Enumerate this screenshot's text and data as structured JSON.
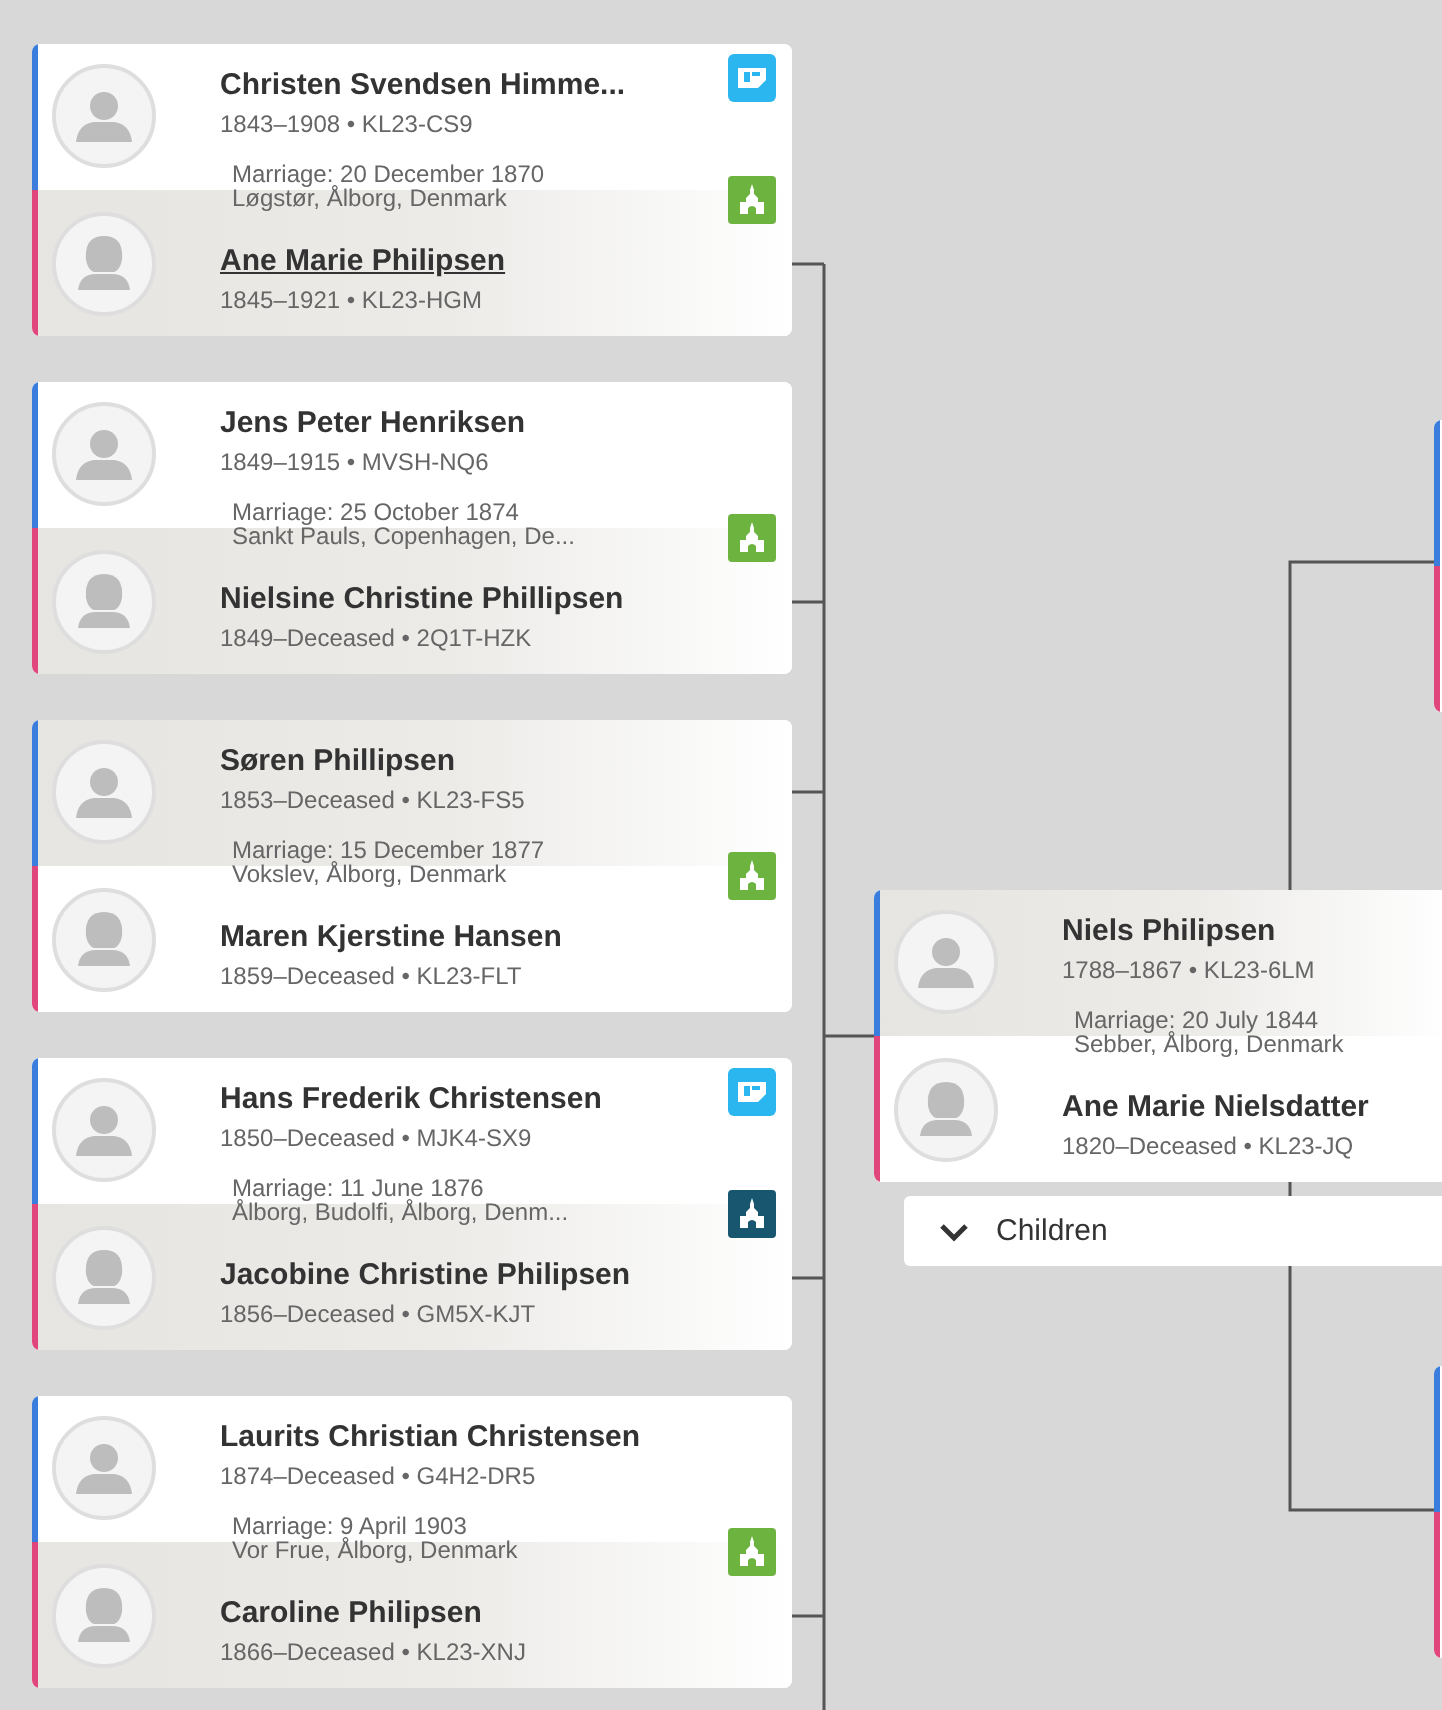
{
  "families": [
    {
      "husband": {
        "name": "Christen Svendsen Himme...",
        "details": "1843–1908 • KL23-CS9",
        "shaded": false,
        "underlined": false,
        "hint": true
      },
      "wife": {
        "name": "Ane Marie Philipsen",
        "details": "1845–1921 • KL23-HGM",
        "shaded": true,
        "underlined": true,
        "hint": false
      },
      "marriage": {
        "date": "Marriage: 20 December 1870",
        "place": "Løgstør, Ålborg, Denmark",
        "color": "#6cb33f"
      }
    },
    {
      "husband": {
        "name": "Jens Peter Henriksen",
        "details": "1849–1915 • MVSH-NQ6",
        "shaded": false,
        "underlined": false,
        "hint": false
      },
      "wife": {
        "name": "Nielsine Christine Phillipsen",
        "details": "1849–Deceased • 2Q1T-HZK",
        "shaded": true,
        "underlined": false,
        "hint": false
      },
      "marriage": {
        "date": "Marriage: 25 October 1874",
        "place": "Sankt Pauls, Copenhagen, De...",
        "color": "#6cb33f"
      }
    },
    {
      "husband": {
        "name": "Søren Phillipsen",
        "details": "1853–Deceased • KL23-FS5",
        "shaded": true,
        "underlined": false,
        "hint": false
      },
      "wife": {
        "name": "Maren Kjerstine Hansen",
        "details": "1859–Deceased • KL23-FLT",
        "shaded": false,
        "underlined": false,
        "hint": false
      },
      "marriage": {
        "date": "Marriage: 15 December 1877",
        "place": "Vokslev, Ålborg, Denmark",
        "color": "#6cb33f"
      }
    },
    {
      "husband": {
        "name": "Hans Frederik Christensen",
        "details": "1850–Deceased • MJK4-SX9",
        "shaded": false,
        "underlined": false,
        "hint": true
      },
      "wife": {
        "name": "Jacobine Christine Philipsen",
        "details": "1856–Deceased • GM5X-KJT",
        "shaded": true,
        "underlined": false,
        "hint": false
      },
      "marriage": {
        "date": "Marriage: 11 June 1876",
        "place": "Ålborg, Budolfi, Ålborg, Denm...",
        "color": "#17566e"
      }
    },
    {
      "husband": {
        "name": "Laurits Christian Christensen",
        "details": "1874–Deceased • G4H2-DR5",
        "shaded": false,
        "underlined": false,
        "hint": false
      },
      "wife": {
        "name": "Caroline Philipsen",
        "details": "1866–Deceased • KL23-XNJ",
        "shaded": true,
        "underlined": false,
        "hint": false
      },
      "marriage": {
        "date": "Marriage: 9 April 1903",
        "place": "Vor Frue, Ålborg, Denmark",
        "color": "#6cb33f"
      }
    }
  ],
  "focus": {
    "husband": {
      "name": "Niels Philipsen",
      "details": "1788–1867 • KL23-6LM",
      "shaded": true,
      "underlined": false,
      "hint": false
    },
    "wife": {
      "name": "Ane Marie Nielsdatter",
      "details": "1820–Deceased • KL23-JQ",
      "shaded": false,
      "underlined": false,
      "hint": false
    },
    "marriage": {
      "date": "Marriage: 20 July 1844",
      "place": "Sebber, Ålborg, Denmark"
    },
    "children_button": {
      "label": "Children",
      "expanded": false
    }
  },
  "parents": [
    {
      "kind": "couple"
    },
    {
      "kind": "couple"
    }
  ]
}
